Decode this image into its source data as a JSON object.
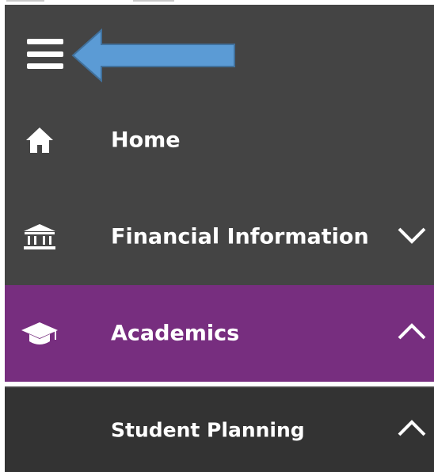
{
  "nav": {
    "menu_icon": "hamburger-menu-icon",
    "items": [
      {
        "label": "Home",
        "icon": "home-icon"
      },
      {
        "label": "Financial Information",
        "icon": "bank-icon",
        "chevron": "chevron-down-icon"
      },
      {
        "label": "Academics",
        "icon": "graduation-cap-icon",
        "chevron": "chevron-up-icon",
        "active": true
      },
      {
        "label": "Student Planning",
        "chevron": "chevron-up-icon"
      }
    ]
  },
  "colors": {
    "panel_bg": "#444444",
    "active_bg": "#772e7f",
    "submenu_bg": "#333333",
    "text": "#ffffff",
    "annotation_arrow": "#5b9bd5"
  }
}
